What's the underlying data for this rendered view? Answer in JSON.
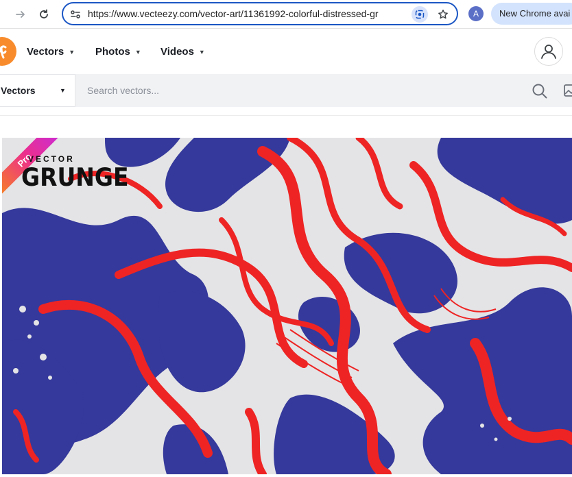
{
  "browser": {
    "url": "https://www.vecteezy.com/vector-art/11361992-colorful-distressed-gr",
    "profile_initial": "A",
    "banner_text": "New Chrome avai"
  },
  "header": {
    "nav": [
      {
        "label": "Vectors"
      },
      {
        "label": "Photos"
      },
      {
        "label": "Videos"
      }
    ]
  },
  "search": {
    "type_selected": "Vectors",
    "placeholder": "Search vectors..."
  },
  "artwork": {
    "badge": "Pro",
    "watermark_top": "VECTOR",
    "watermark_bottom": "GRUNGE",
    "colors": {
      "red": "#ee2424",
      "blue": "#35399b",
      "paper": "#e4e4e6"
    }
  },
  "colors": {
    "accent": "#1a56c4",
    "brand": "#f88c2d"
  }
}
